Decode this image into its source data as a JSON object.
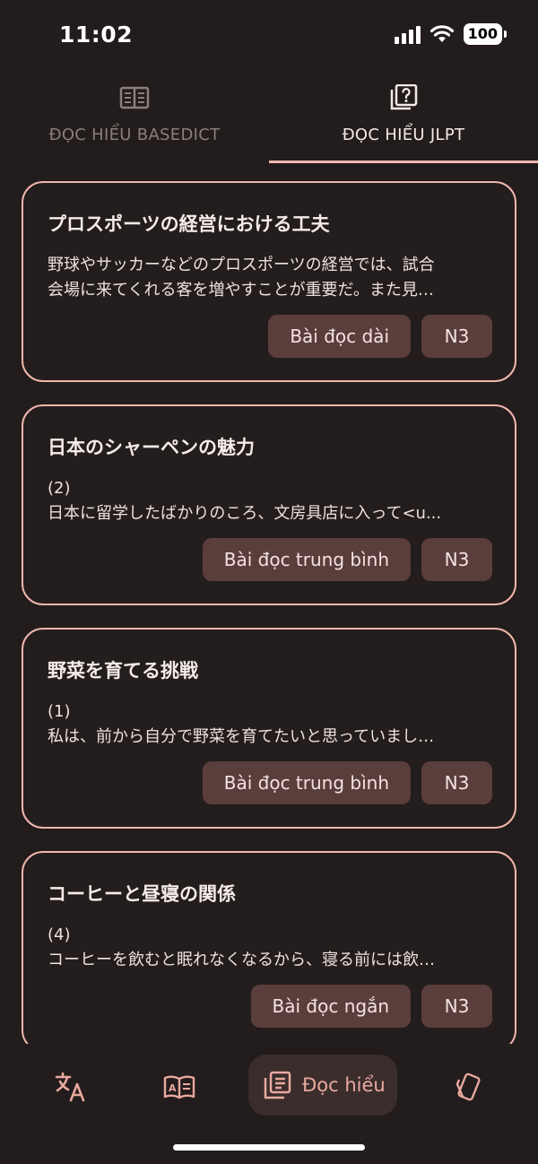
{
  "status_bar": {
    "time": "11:02",
    "battery": "100"
  },
  "top_tabs": [
    {
      "label": "ĐỌC HIỂU BASEDICT",
      "icon": "book-columns-icon",
      "active": false
    },
    {
      "label": "ĐỌC HIỂU JLPT",
      "icon": "question-book-icon",
      "active": true
    }
  ],
  "cards": [
    {
      "title": "プロスポーツの経営における工夫",
      "lines": [
        "野球やサッカーなどのプロスポーツの経営では、試合",
        "会場に来てくれる客を増やすことが重要だ。また見…"
      ],
      "type": "Bài đọc dài",
      "level": "N3"
    },
    {
      "title": "日本のシャーペンの魅力",
      "lines": [
        "(2)",
        "日本に留学したばかりのころ、文房具店に入って<u..."
      ],
      "type": "Bài đọc trung bình",
      "level": "N3"
    },
    {
      "title": "野菜を育てる挑戦",
      "lines": [
        "(1)",
        "私は、前から自分で野菜を育てたいと思っていまし…"
      ],
      "type": "Bài đọc trung bình",
      "level": "N3"
    },
    {
      "title": "コーヒーと昼寝の関係",
      "lines": [
        "(4)",
        "コーヒーを飲むと眠れなくなるから、寝る前には飲…"
      ],
      "type": "Bài đọc ngắn",
      "level": "N3"
    }
  ],
  "bottom_nav": {
    "items": [
      {
        "icon": "translate-icon"
      },
      {
        "icon": "open-book-icon"
      },
      {
        "icon": "reading-list-icon",
        "label": "Đọc hiểu",
        "active": true
      },
      {
        "icon": "flashcards-icon"
      }
    ],
    "active_label": "Đọc hiểu"
  },
  "colors": {
    "background": "#221c1c",
    "accent": "#efb6ac",
    "tag_background": "#5a3e3c",
    "nav_active_background": "#3a2d2c"
  }
}
